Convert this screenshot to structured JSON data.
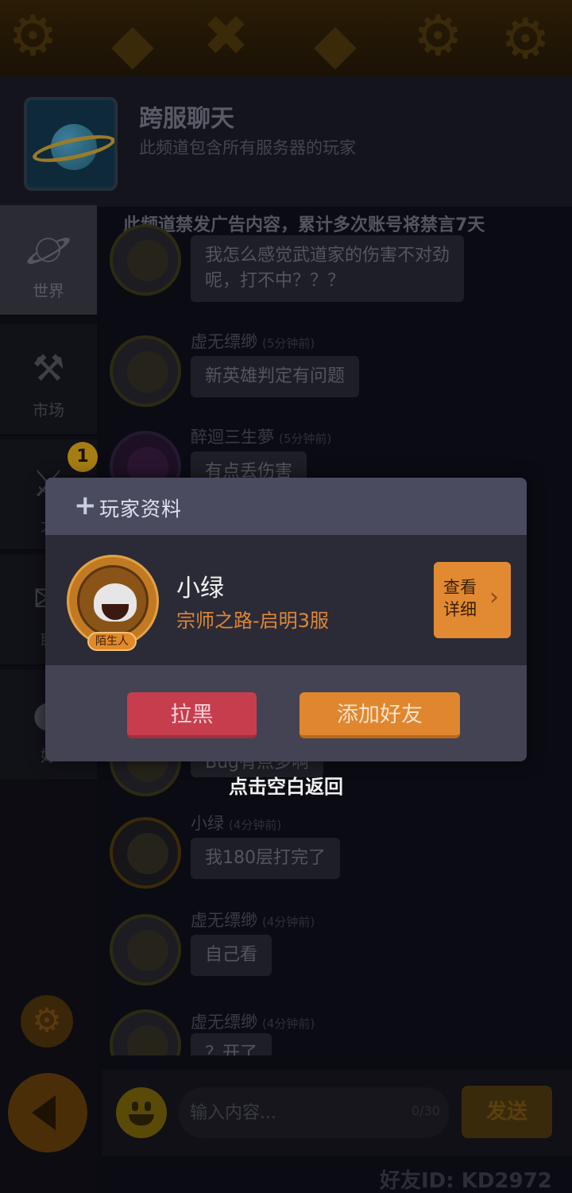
{
  "channel": {
    "title": "跨服聊天",
    "subtitle": "此频道包含所有服务器的玩家",
    "notice": "此频道禁发广告内容，累计多次账号将禁言7天"
  },
  "sidebar": {
    "items": [
      {
        "label": "世界",
        "icon": "planet-icon"
      },
      {
        "label": "市场",
        "icon": "gavel-icon"
      },
      {
        "label": "大",
        "icon": "crossed-swords-icon"
      },
      {
        "label": "聊",
        "icon": "chat-icon"
      },
      {
        "label": "好",
        "icon": "person-icon"
      }
    ],
    "badge": "1"
  },
  "messages": [
    {
      "name": "",
      "time": "",
      "text": "我怎么感觉武道家的伤害不对劲\n呢，打不中？？？"
    },
    {
      "name": "虚无缥缈",
      "time": "(5分钟前)",
      "text": "新英雄判定有问题"
    },
    {
      "name": "醉迴三生夢",
      "time": "(5分钟前)",
      "text": "有点丢伤害"
    },
    {
      "name": "",
      "time": "",
      "text": "Bug有点多啊"
    },
    {
      "name": "小绿",
      "time": "(4分钟前)",
      "text": "我180层打完了"
    },
    {
      "name": "虚无缥缈",
      "time": "(4分钟前)",
      "text": "自己看"
    },
    {
      "name": "虚无缥缈",
      "time": "(4分钟前)",
      "text": "？开了"
    }
  ],
  "input": {
    "placeholder": "输入内容...",
    "counter": "0/30",
    "send_label": "发送"
  },
  "friend_id": "好友ID: KD2972",
  "modal": {
    "title": "玩家资料",
    "player_name": "小绿",
    "player_server": "宗师之路-启明3服",
    "stranger_tag": "陌生人",
    "detail_label": "查看\n详细",
    "block_label": "拉黑",
    "add_friend_label": "添加好友"
  },
  "tap_hint": "点击空白返回"
}
